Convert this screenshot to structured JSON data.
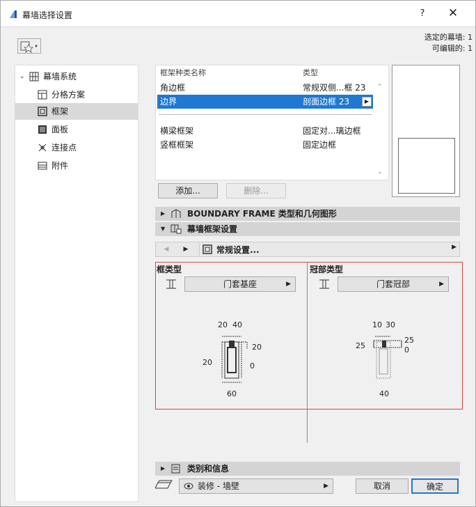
{
  "window": {
    "title": "幕墙选择设置",
    "help": "?",
    "close": "✕"
  },
  "selection_info": {
    "selected": "选定的幕墙: 1",
    "editable": "可编辑的: 1"
  },
  "tree": {
    "items": [
      {
        "label": "幕墙系统",
        "icon": "grid-icon"
      },
      {
        "label": "分格方案",
        "icon": "scheme-icon"
      },
      {
        "label": "框架",
        "icon": "frame-icon"
      },
      {
        "label": "面板",
        "icon": "panel-icon"
      },
      {
        "label": "连接点",
        "icon": "junction-icon"
      },
      {
        "label": "附件",
        "icon": "accessory-icon"
      }
    ]
  },
  "frame_list": {
    "header_name": "框架种类名称",
    "header_type": "类型",
    "rows": [
      {
        "name": "角边框",
        "type": "常规双侧...框 23"
      },
      {
        "name": "边界",
        "type": "剖面边框 23"
      },
      {
        "name": "横梁框架",
        "type": "固定对...璃边框"
      },
      {
        "name": "竖框框架",
        "type": "固定边框"
      }
    ],
    "add_label": "添加...",
    "delete_label": "删除..."
  },
  "sections": {
    "boundary": "BOUNDARY FRAME 类型和几何图形",
    "frame_settings": "幕墙框架设置",
    "category": "类别和信息"
  },
  "nav": {
    "selected": "常规设置..."
  },
  "frame_type": {
    "title": "框类型",
    "value": "门套基座",
    "dims": {
      "top_a": "20",
      "top_b": "40",
      "right_top": "20",
      "left": "20",
      "right": "0",
      "bottom": "60"
    }
  },
  "cap_type": {
    "title": "冠部类型",
    "value": "门套冠部",
    "dims": {
      "top_a": "10",
      "top_b": "30",
      "left": "25",
      "right_top": "25",
      "right": "0",
      "bottom": "40"
    }
  },
  "footer": {
    "layer": "装修 - 墙壁",
    "cancel": "取消",
    "ok": "确定"
  },
  "colors": {
    "selection": "#1f78d1",
    "frame_panel_border": "#e04040"
  }
}
